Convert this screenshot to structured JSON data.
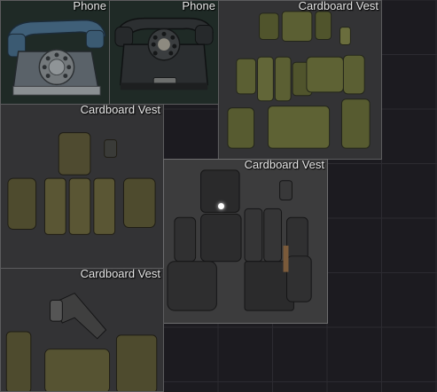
{
  "inventory": {
    "items": [
      {
        "label": "Phone",
        "icon": "rotary-phone-blue-icon"
      },
      {
        "label": "Phone",
        "icon": "rotary-phone-black-icon"
      },
      {
        "label": "Cardboard Vest",
        "icon": "tactical-vest-icon"
      },
      {
        "label": "Cardboard Vest",
        "icon": "tactical-vest-icon"
      },
      {
        "label": "Cardboard Vest",
        "icon": "tactical-vest-icon"
      },
      {
        "label": "Cardboard Vest",
        "icon": "tactical-vest-icon"
      }
    ],
    "colors": {
      "slot_background": "#333335",
      "phone_slot_background": "#1f2a26",
      "grid_background": "#1c1b20",
      "slot_border": "#5c5c5e",
      "label_text": "#e8e8e8",
      "olive_gear": "#5e6234",
      "phone_blue": "#3f5f78"
    }
  }
}
